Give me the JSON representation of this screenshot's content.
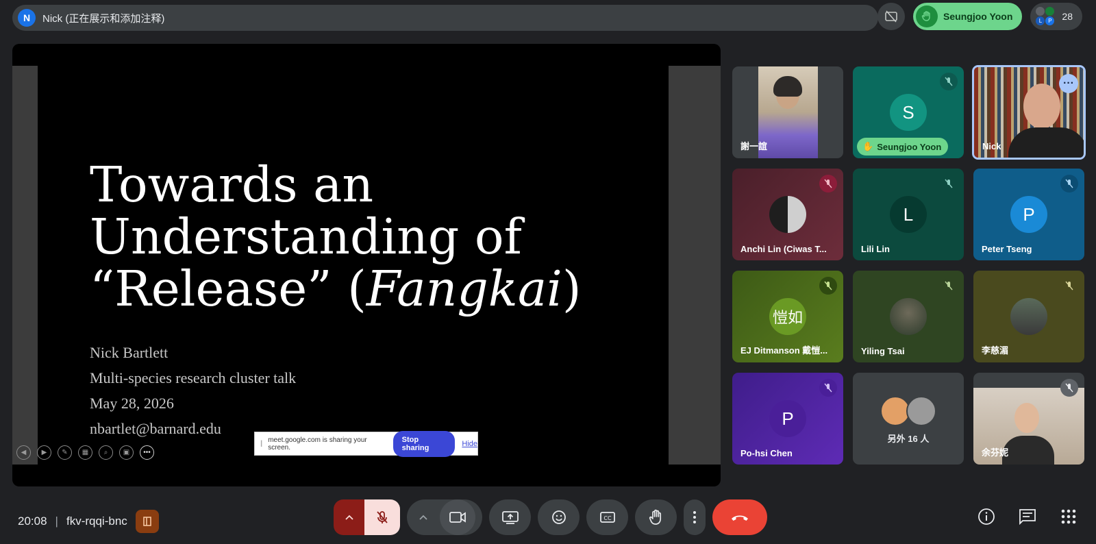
{
  "presenter": {
    "initial": "N",
    "label": "Nick (正在展示和添加注释)"
  },
  "top_right": {
    "raised_hand_name": "Seungjoo Yoon",
    "participant_count": "28",
    "mini_avatar_letters": [
      "L",
      "P"
    ]
  },
  "slide": {
    "title_line1": "Towards an",
    "title_line2": "Understanding of",
    "title_line3_prefix": "“Release” (",
    "title_line3_italic": "Fangkai",
    "title_line3_suffix": ")",
    "author": "Nick Bartlett",
    "event": "Multi-species research cluster talk",
    "date": "May 28, 2026",
    "email": "nbartlet@barnard.edu"
  },
  "share_banner": {
    "message": "meet.google.com is sharing your screen.",
    "stop_label": "Stop sharing",
    "hide_label": "Hide"
  },
  "tiles": {
    "t1": {
      "name": "謝一誼"
    },
    "t2": {
      "name": "Seungjoo Yoon",
      "initial": "S"
    },
    "t3": {
      "name": "Nick"
    },
    "t4": {
      "name": "Anchi Lin (Ciwas T..."
    },
    "t5": {
      "name": "Lili Lin",
      "initial": "L"
    },
    "t6": {
      "name": "Peter Tseng",
      "initial": "P"
    },
    "t7": {
      "name": "EJ Ditmanson 戴愷...",
      "initial": "愷如"
    },
    "t8": {
      "name": "Yiling Tsai"
    },
    "t9": {
      "name": "李慈湄"
    },
    "t10": {
      "name": "Po-hsi Chen",
      "initial": "P"
    },
    "t11": {
      "name": "另外 16 人"
    },
    "t12": {
      "name": "余芬妮"
    }
  },
  "bottom": {
    "time": "20:08",
    "separator": "|",
    "meeting_code": "fkv-rqqi-bnc"
  },
  "colors": {
    "accent_blue": "#a8c7fa",
    "hand_green": "#6dd58c",
    "leave_red": "#ea4335",
    "stop_sharing_blue": "#3b47d6"
  }
}
